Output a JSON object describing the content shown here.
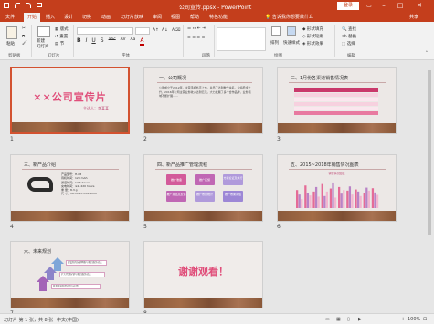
{
  "window": {
    "title": "公司宣传.ppsx - PowerPoint",
    "signin": "登录",
    "min": "–",
    "max": "□",
    "close": "✕"
  },
  "tabs": [
    "文件",
    "开始",
    "插入",
    "设计",
    "切换",
    "动画",
    "幻灯片放映",
    "审阅",
    "视图",
    "帮助",
    "特色功能"
  ],
  "active_tab": "开始",
  "tell_me": "告诉我你想要做什么",
  "share": "共享",
  "ribbon": {
    "clipboard": {
      "paste": "粘贴",
      "label": "剪贴板"
    },
    "slides": {
      "new_slide": "新建\n幻灯片",
      "layout": "版式",
      "reset": "重置",
      "section": "节",
      "label": "幻灯片"
    },
    "font": {
      "label": "字体",
      "format": [
        "B",
        "I",
        "U",
        "S",
        "abc",
        "AV",
        "Aa",
        "A"
      ]
    },
    "paragraph": {
      "label": "段落"
    },
    "drawing": {
      "label": "绘图",
      "arrange": "排列",
      "quick_styles": "快速样式",
      "fill": "形状填充",
      "outline": "形状轮廓",
      "effect": "形状效果"
    },
    "editing": {
      "label": "编辑",
      "find": "查找",
      "replace": "替换",
      "select": "选择"
    }
  },
  "slides": [
    {
      "num": "1",
      "title": "××公司宣传片",
      "subtitle": "主讲人：李某某"
    },
    {
      "num": "2",
      "title": "一、公司概况",
      "body": "公司成立于2012年，主营手机外壳上市，总员工达到数千余名，业绩稳步上升，2016年公司主营业务收入达到亿元。大力发展了多个合作品牌，业务领域不断扩展……"
    },
    {
      "num": "3",
      "title": "三、1月份各渠道销售情况表"
    },
    {
      "num": "4",
      "title": "三、新产品介绍",
      "specs": [
        "产品型号：H-08",
        "待机时间：120 mAh",
        "通话时间：12 h hours",
        "充电时间：≤1 .220 hours",
        "重    量：8.3 g",
        "尺    寸：18.5×43.5×6.8mm"
      ]
    },
    {
      "num": "5",
      "title": "四、新产品推广管理流程",
      "boxes": [
        "推广准备",
        "推广实施",
        "方案论证及执行",
        "推广总结及反馈",
        "推广效果统计",
        "推广效果评估"
      ]
    },
    {
      "num": "6",
      "title": "五、2015~2018年销售情况图表",
      "chart_title": "销售情况图表"
    },
    {
      "num": "7",
      "title": "六、未来规划",
      "items": [
        "建设新的分销网络与售后服务站点",
        "扩大代理分销与售后服务站点",
        "开发更多新型产品与应用"
      ]
    },
    {
      "num": "8",
      "title": "谢谢观看！"
    }
  ],
  "status": {
    "slide_info": "幻灯片 第 1 张，共 8 张",
    "lang": "中文(中国)",
    "zoom": "100%"
  },
  "chart_data": {
    "type": "bar",
    "title": "销售情况图表",
    "categories": [
      "1",
      "2",
      "3",
      "4",
      "5",
      "6",
      "7",
      "8",
      "9",
      "10"
    ],
    "series": [
      {
        "values": [
          60,
          75,
          55,
          80,
          65,
          70,
          58,
          62,
          50,
          66
        ]
      },
      {
        "values": [
          45,
          50,
          70,
          40,
          85,
          48,
          72,
          55,
          68,
          52
        ]
      },
      {
        "values": [
          30,
          42,
          38,
          55,
          35,
          60,
          45,
          40,
          58,
          44
        ]
      }
    ],
    "colors": [
      "#e56b97",
      "#b983c6",
      "#f3b6cf"
    ]
  }
}
